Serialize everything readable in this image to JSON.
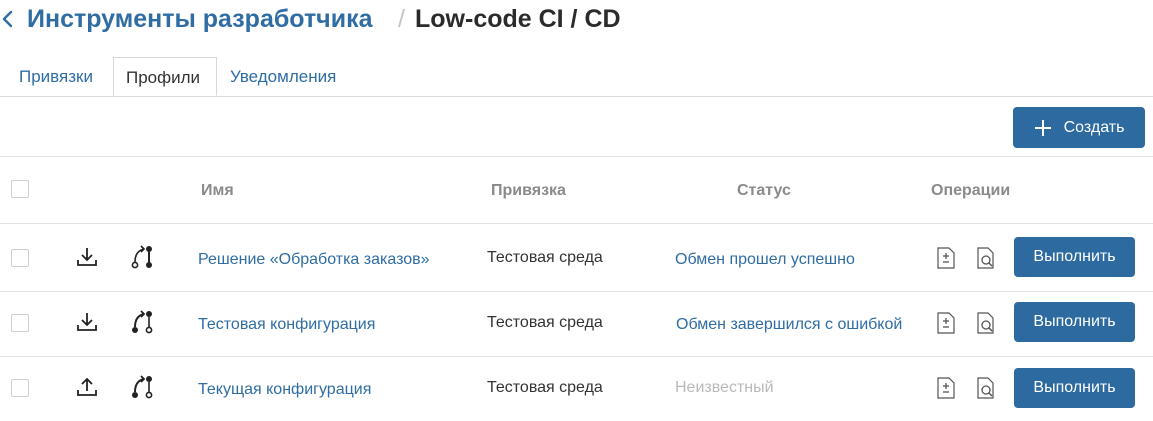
{
  "header": {
    "breadcrumb_parent": "Инструменты разработчика",
    "separator": "/",
    "title": "Low-code CI / CD"
  },
  "tabs": [
    {
      "label": "Привязки",
      "active": false
    },
    {
      "label": "Профили",
      "active": true
    },
    {
      "label": "Уведомления",
      "active": false
    }
  ],
  "toolbar": {
    "create_label": "Создать"
  },
  "table": {
    "columns": {
      "name": "Имя",
      "binding": "Привязка",
      "status": "Статус",
      "operations": "Операции"
    },
    "rows": [
      {
        "direction_icon": "download-icon",
        "name": "Решение «Обработка заказов»",
        "binding": "Тестовая среда",
        "status": "Обмен прошел успешно",
        "status_kind": "success",
        "action": "Выполнить"
      },
      {
        "direction_icon": "download-icon",
        "name": "Тестовая конфигурация",
        "binding": "Тестовая среда",
        "status": "Обмен завершился с ошибкой",
        "status_kind": "error",
        "action": "Выполнить"
      },
      {
        "direction_icon": "upload-icon",
        "name": "Текущая конфигурация",
        "binding": "Тестовая среда",
        "status": "Неизвестный",
        "status_kind": "unknown",
        "action": "Выполнить"
      }
    ]
  },
  "colors": {
    "accent": "#2c6aa0",
    "link": "#2f6da3",
    "muted": "#b9b9b9"
  }
}
